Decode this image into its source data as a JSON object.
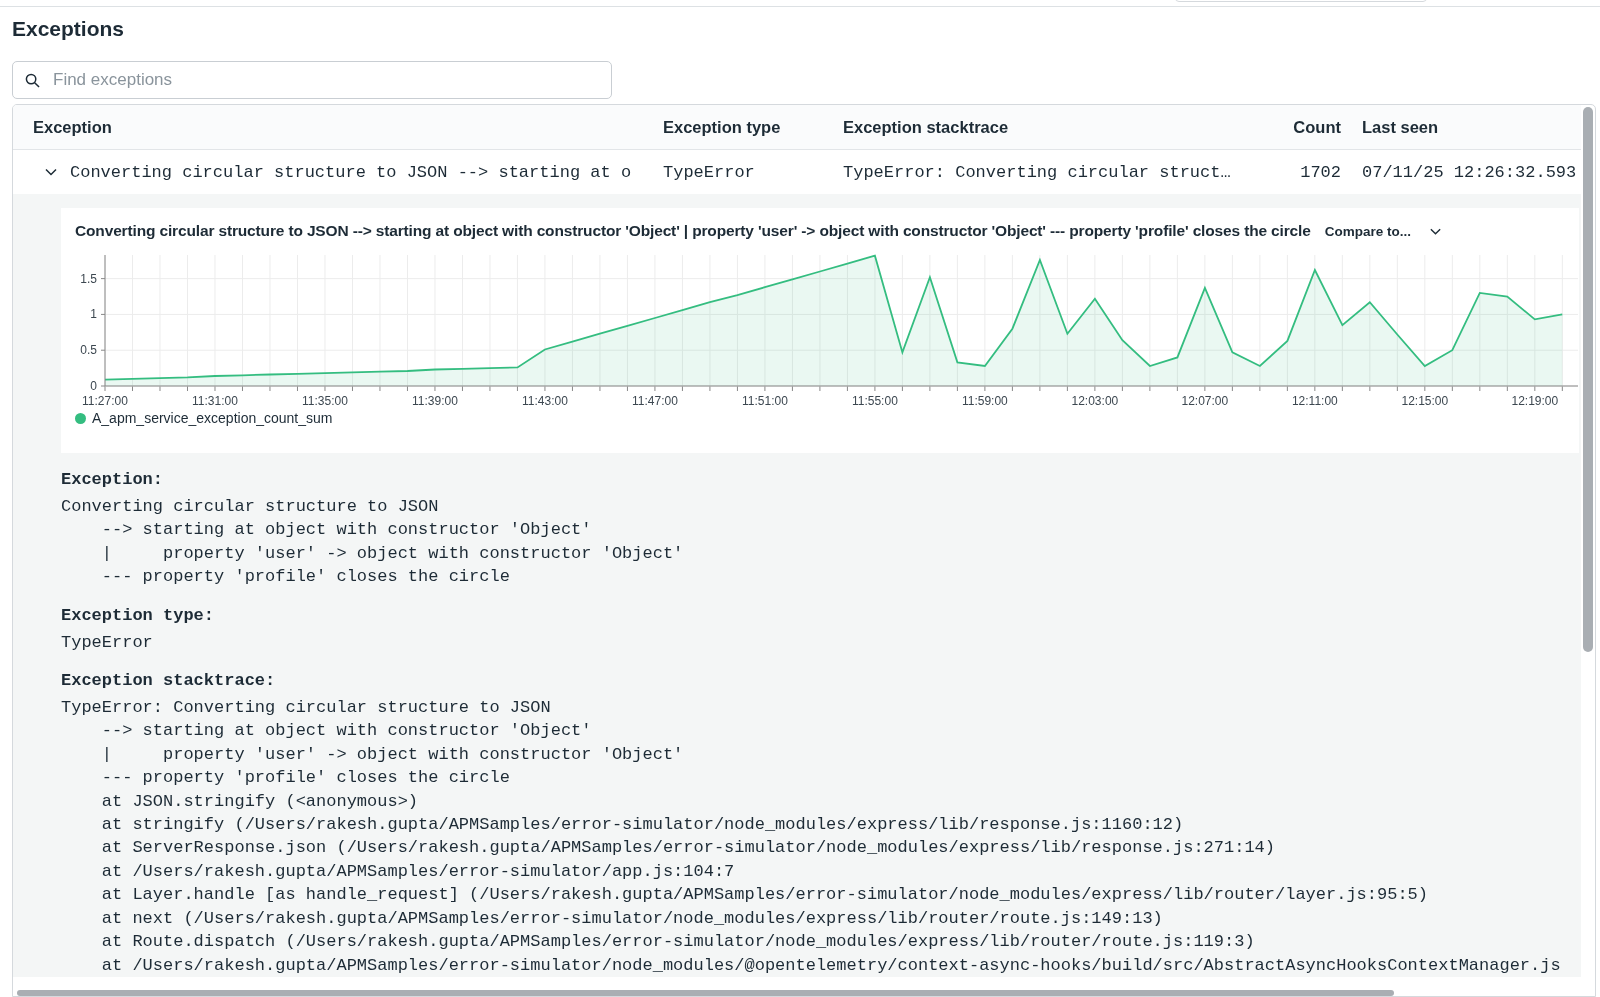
{
  "header": {
    "title": "Exceptions"
  },
  "search": {
    "placeholder": "Find exceptions"
  },
  "table": {
    "columns": [
      "Exception",
      "Exception type",
      "Exception stacktrace",
      "Count",
      "Last seen"
    ],
    "rows": [
      {
        "expanded": true,
        "cells": [
          "Converting circular structure to JSON --> starting at o",
          "TypeError",
          "TypeError: Converting circular struct…",
          "1702",
          "07/11/25 12:26:32.593"
        ],
        "detail": {
          "chart": {
            "title": "Converting circular structure to JSON --> starting at object with constructor 'Object' | property 'user' -> object with constructor 'Object' --- property 'profile' closes the circle",
            "compare": "Compare to...",
            "chart_data": {
              "type": "area",
              "grid": true,
              "categories": [
                "11:27:00",
                null,
                null,
                null,
                "11:31:00",
                null,
                null,
                null,
                "11:35:00",
                null,
                null,
                null,
                "11:39:00",
                null,
                null,
                null,
                "11:43:00",
                null,
                null,
                null,
                "11:47:00",
                null,
                null,
                null,
                "11:51:00",
                null,
                null,
                null,
                "11:55:00",
                null,
                null,
                null,
                "11:59:00",
                null,
                null,
                null,
                "12:03:00",
                null,
                null,
                null,
                "12:07:00",
                null,
                null,
                null,
                "12:11:00",
                null,
                null,
                null,
                "12:15:00",
                null,
                null,
                null,
                "12:19:00",
                null
              ],
              "series": [
                {
                  "name": "A_apm_service_exception_count_sum",
                  "color": "#34bd80",
                  "values": [
                    0.09,
                    0.1,
                    0.11,
                    0.12,
                    0.14,
                    0.15,
                    0.16,
                    0.17,
                    0.18,
                    0.19,
                    0.2,
                    0.21,
                    0.23,
                    0.24,
                    0.25,
                    0.26,
                    0.51,
                    0.62,
                    0.73,
                    0.84,
                    0.95,
                    1.06,
                    1.17,
                    1.27,
                    1.38,
                    1.49,
                    1.6,
                    1.71,
                    1.82,
                    0.47,
                    1.52,
                    0.33,
                    0.28,
                    0.8,
                    1.76,
                    0.73,
                    1.22,
                    0.64,
                    0.28,
                    0.4,
                    1.37,
                    0.47,
                    0.28,
                    0.63,
                    1.62,
                    0.85,
                    1.17,
                    0.72,
                    0.28,
                    0.5,
                    1.3,
                    1.25,
                    0.93,
                    1.0
                  ]
                }
              ],
              "ylim": [
                0,
                1.83
              ],
              "yticks": [
                0,
                {
                  "value": 0.5,
                  "label": "0.5"
                },
                1,
                {
                  "value": 1.5,
                  "label": "1.5"
                }
              ]
            }
          },
          "sections": [
            {
              "label": "Exception:",
              "lines": [
                "Converting circular structure to JSON",
                "    --> starting at object with constructor 'Object'",
                "    |     property 'user' -> object with constructor 'Object'",
                "    --- property 'profile' closes the circle"
              ]
            },
            {
              "label": "Exception type:",
              "lines": [
                "TypeError"
              ]
            },
            {
              "label": "Exception stacktrace:",
              "lines": [
                "TypeError: Converting circular structure to JSON",
                "    --> starting at object with constructor 'Object'",
                "    |     property 'user' -> object with constructor 'Object'",
                "    --- property 'profile' closes the circle",
                "    at JSON.stringify (<anonymous>)",
                "    at stringify (/Users/rakesh.gupta/APMSamples/error-simulator/node_modules/express/lib/response.js:1160:12)",
                "    at ServerResponse.json (/Users/rakesh.gupta/APMSamples/error-simulator/node_modules/express/lib/response.js:271:14)",
                "    at /Users/rakesh.gupta/APMSamples/error-simulator/app.js:104:7",
                "    at Layer.handle [as handle_request] (/Users/rakesh.gupta/APMSamples/error-simulator/node_modules/express/lib/router/layer.js:95:5)",
                "    at next (/Users/rakesh.gupta/APMSamples/error-simulator/node_modules/express/lib/router/route.js:149:13)",
                "    at Route.dispatch (/Users/rakesh.gupta/APMSamples/error-simulator/node_modules/express/lib/router/route.js:119:3)",
                "    at /Users/rakesh.gupta/APMSamples/error-simulator/node_modules/@opentelemetry/context-async-hooks/build/src/AbstractAsyncHooksContextManager.js"
              ]
            }
          ]
        }
      }
    ]
  }
}
